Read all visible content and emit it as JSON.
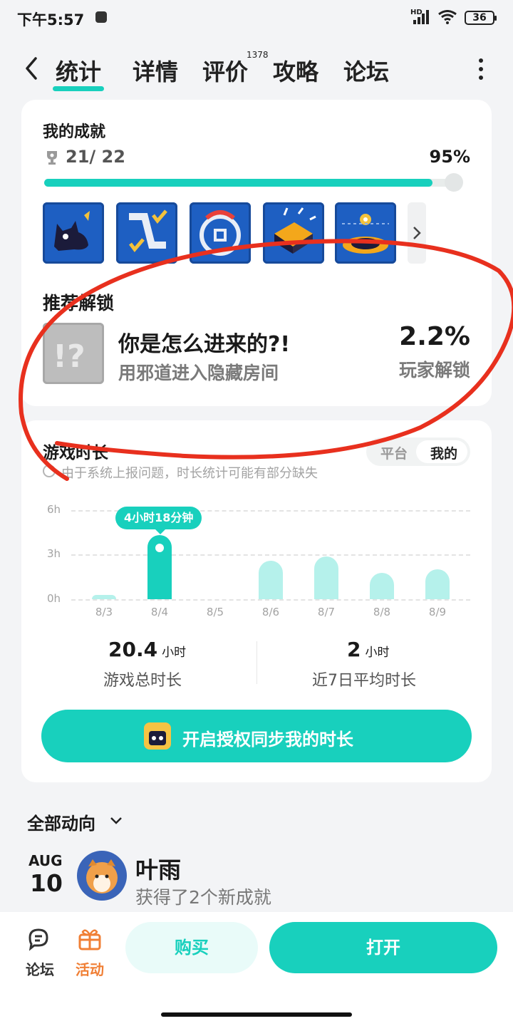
{
  "status": {
    "time": "下午5:57",
    "network": "HD",
    "battery": "36"
  },
  "nav": {
    "tabs": [
      {
        "label": "统计",
        "active": true
      },
      {
        "label": "详情"
      },
      {
        "label": "评价"
      },
      {
        "label": "攻略"
      },
      {
        "label": "论坛"
      }
    ],
    "review_count": "1378"
  },
  "achievements": {
    "title": "我的成就",
    "count": "21/ 22",
    "percent": "95%",
    "progress": 0.95,
    "badges": [
      "cat-badge",
      "path-check-badge",
      "controller-badge",
      "box-badge",
      "ufo-badge"
    ]
  },
  "recommend": {
    "title": "推荐解锁",
    "name": "你是怎么进来的?!",
    "desc": "用邪道进入隐藏房间",
    "percent": "2.2%",
    "percent_label": "玩家解锁"
  },
  "playtime": {
    "title": "游戏时长",
    "toggle": [
      "平台",
      "我的"
    ],
    "note": "由于系统上报问题，时长统计可能有部分缺失",
    "tooltip": "4小时18分钟",
    "total_value": "20.4",
    "total_unit": "小时",
    "total_label": "游戏总时长",
    "avg_value": "2",
    "avg_unit": "小时",
    "avg_label": "近7日平均时长",
    "sync_label": "开启授权同步我的时长"
  },
  "chart_data": {
    "type": "bar",
    "categories": [
      "8/3",
      "8/4",
      "8/5",
      "8/6",
      "8/7",
      "8/8",
      "8/9"
    ],
    "values": [
      0.3,
      4.3,
      0,
      2.6,
      2.9,
      1.8,
      2.0
    ],
    "y_ticks": [
      "0h",
      "3h",
      "6h"
    ],
    "ylim": [
      0,
      6
    ],
    "highlight_index": 1
  },
  "feed": {
    "title": "全部动向",
    "month": "AUG",
    "day": "10",
    "user": "叶雨",
    "action": "获得了2个新成就"
  },
  "bottom": {
    "forum": "论坛",
    "activity": "活动",
    "buy": "购买",
    "open": "打开"
  },
  "colors": {
    "accent": "#18d0bd",
    "annotation": "#e8301e"
  }
}
